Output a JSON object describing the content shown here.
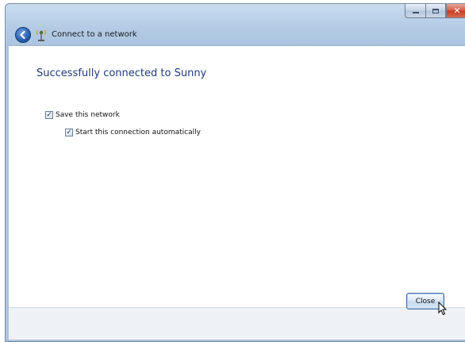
{
  "window": {
    "title": "Connect to a network"
  },
  "content": {
    "heading": "Successfully connected to Sunny",
    "options": [
      {
        "label": "Save this network",
        "checked": true
      },
      {
        "label": "Start this connection automatically",
        "checked": true
      }
    ]
  },
  "footer": {
    "close_label": "Close"
  },
  "icons": {
    "back": "back-arrow-icon",
    "network": "network-icon",
    "minimize": "minimize-icon",
    "maximize": "maximize-icon",
    "close": "close-icon",
    "cursor": "mouse-cursor-icon"
  },
  "colors": {
    "heading": "#1e3a7e",
    "titlebar": "#b3cbe4",
    "close_caption": "#c23b22"
  }
}
